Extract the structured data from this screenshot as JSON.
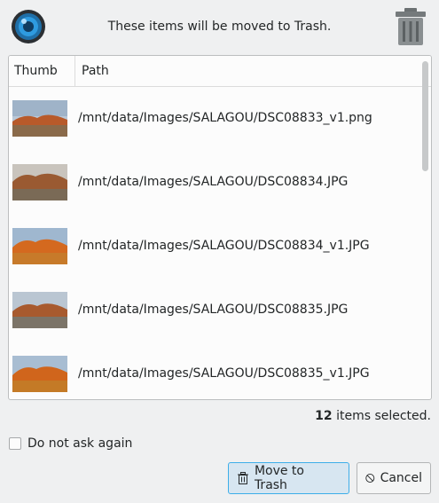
{
  "header": {
    "message": "These items will be moved to Trash."
  },
  "list": {
    "columns": {
      "thumb": "Thumb",
      "path": "Path"
    },
    "rows": [
      {
        "path": "/mnt/data/Images/SALAGOU/DSC08833_v1.png"
      },
      {
        "path": "/mnt/data/Images/SALAGOU/DSC08834.JPG"
      },
      {
        "path": "/mnt/data/Images/SALAGOU/DSC08834_v1.JPG"
      },
      {
        "path": "/mnt/data/Images/SALAGOU/DSC08835.JPG"
      },
      {
        "path": "/mnt/data/Images/SALAGOU/DSC08835_v1.JPG"
      }
    ]
  },
  "status": {
    "count": "12",
    "count_suffix": "items selected."
  },
  "options": {
    "do_not_ask_label": "Do not ask again",
    "do_not_ask_checked": false
  },
  "buttons": {
    "move_label": "Move to Trash",
    "cancel_label": "Cancel"
  },
  "colors": {
    "accent": "#3daee9",
    "window_bg": "#eff0f1"
  },
  "icons": {
    "app": "camera-lens-icon",
    "header_trash": "trash-can-icon",
    "move": "trash-icon",
    "cancel": "cancel-circle-icon"
  }
}
